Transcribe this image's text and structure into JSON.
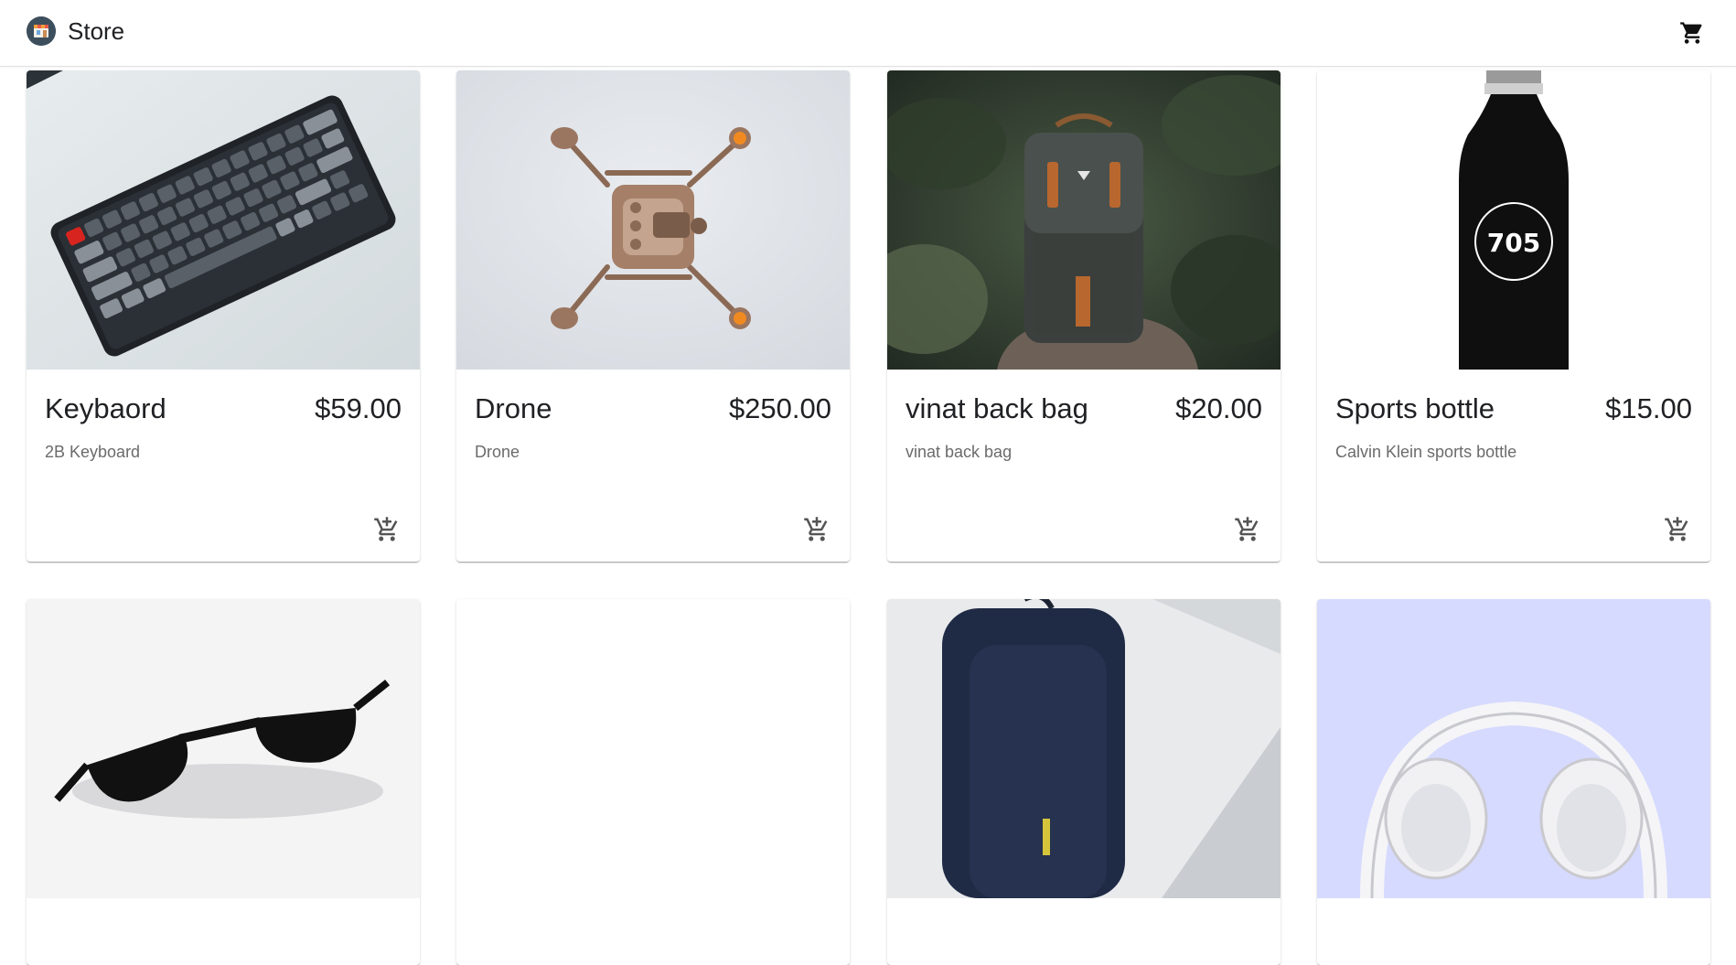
{
  "app": {
    "title": "Store",
    "cart_icon": "shopping-cart-icon"
  },
  "products": [
    {
      "name": "Keybaord",
      "price": "$59.00",
      "description": "2B Keyboard",
      "image": "keyboard-image"
    },
    {
      "name": "Drone",
      "price": "$250.00",
      "description": "Drone",
      "image": "drone-image"
    },
    {
      "name": "vinat back bag",
      "price": "$20.00",
      "description": "vinat back bag",
      "image": "backpack-image"
    },
    {
      "name": "Sports bottle",
      "price": "$15.00",
      "description": "Calvin Klein sports bottle",
      "image": "bottle-image"
    },
    {
      "image": "sunglasses-image"
    },
    {
      "image": "blank-image"
    },
    {
      "image": "navy-backpack-image"
    },
    {
      "image": "headphones-image"
    }
  ],
  "add_to_cart_icon": "add-shopping-cart-icon",
  "colors": {
    "appbar_bg": "#ffffff",
    "text": "#202124",
    "secondary_text": "#6b6b6b",
    "headphones_bg": "#d6dafe"
  }
}
